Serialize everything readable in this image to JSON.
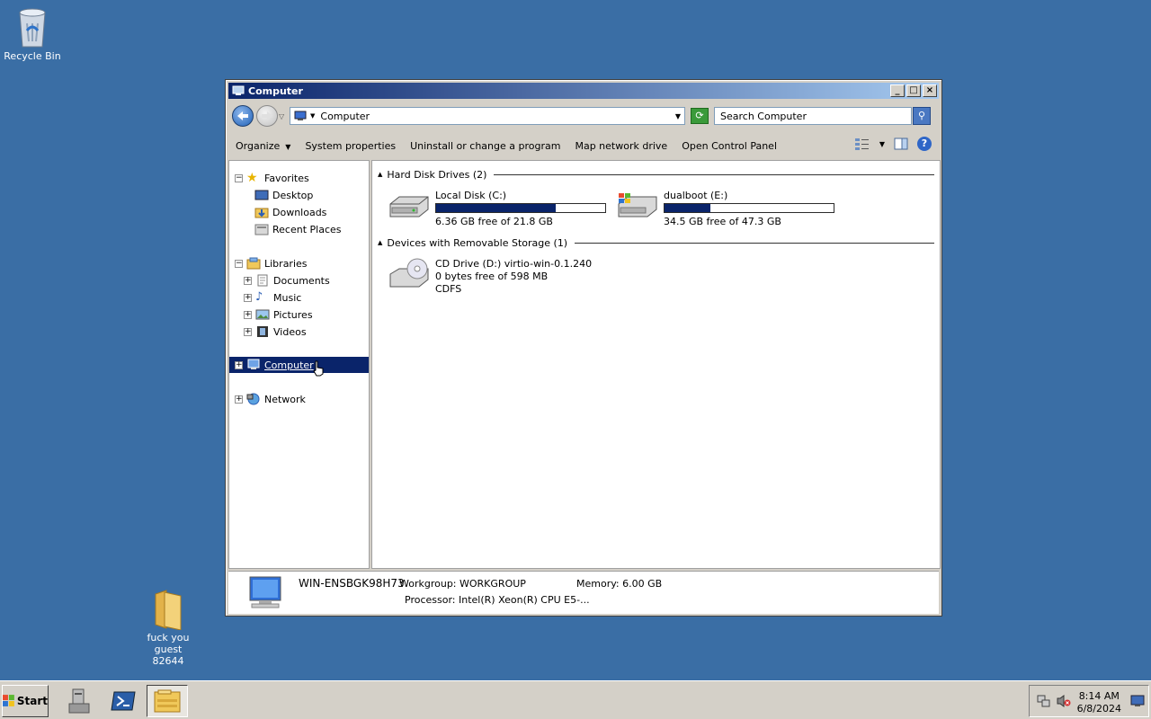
{
  "desktop": {
    "recycle_bin": "Recycle Bin",
    "folder_line1": "fuck you guest",
    "folder_line2": "82644"
  },
  "window": {
    "title": "Computer",
    "address": "Computer",
    "search_placeholder": "Search Computer",
    "commands": {
      "organize": "Organize",
      "system_properties": "System properties",
      "uninstall": "Uninstall or change a program",
      "map_drive": "Map network drive",
      "control_panel": "Open Control Panel"
    }
  },
  "nav": {
    "favorites": "Favorites",
    "desktop": "Desktop",
    "downloads": "Downloads",
    "recent": "Recent Places",
    "libraries": "Libraries",
    "documents": "Documents",
    "music": "Music",
    "pictures": "Pictures",
    "videos": "Videos",
    "computer": "Computer",
    "network": "Network"
  },
  "content": {
    "hdd_header": "Hard Disk Drives (2)",
    "removable_header": "Devices with Removable Storage (1)",
    "drive_c": {
      "name": "Local Disk (C:)",
      "free": "6.36 GB free of 21.8 GB",
      "used_fraction": 0.71
    },
    "drive_e": {
      "name": "dualboot (E:)",
      "free": "34.5 GB free of 47.3 GB",
      "used_fraction": 0.27
    },
    "drive_d": {
      "name": "CD Drive (D:) virtio-win-0.1.240",
      "free": "0 bytes free of 598 MB",
      "fs": "CDFS"
    }
  },
  "details": {
    "computer_name": "WIN-ENSBGK98H73",
    "workgroup": "Workgroup: WORKGROUP",
    "memory": "Memory: 6.00 GB",
    "processor": "Processor: Intel(R) Xeon(R) CPU E5-..."
  },
  "taskbar": {
    "start": "Start",
    "time": "8:14 AM",
    "date": "6/8/2024"
  }
}
